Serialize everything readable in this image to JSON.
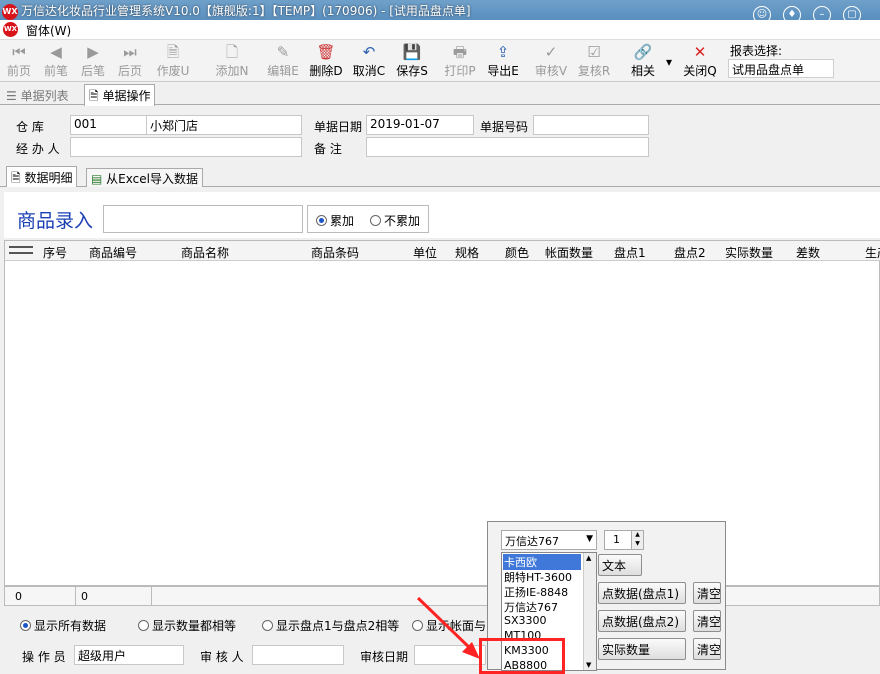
{
  "window": {
    "title": "万信达化妆品行业管理系统V10.0【旗舰版:1】【TEMP】(170906) - [试用品盘点单]",
    "menu": "窗体(W)"
  },
  "toolbar": {
    "buttons": [
      {
        "label": "前页",
        "icon": "⏮",
        "enabled": false
      },
      {
        "label": "前笔",
        "icon": "◀",
        "enabled": false
      },
      {
        "label": "后笔",
        "icon": "▶",
        "enabled": false
      },
      {
        "label": "后页",
        "icon": "⏭",
        "enabled": false
      },
      {
        "label": "作废U",
        "icon": "🗎",
        "enabled": false
      },
      {
        "label": "添加N",
        "icon": "🗋",
        "enabled": false
      },
      {
        "label": "编辑E",
        "icon": "✎",
        "enabled": false
      },
      {
        "label": "删除D",
        "icon": "🗑",
        "enabled": true
      },
      {
        "label": "取消C",
        "icon": "↶",
        "enabled": true
      },
      {
        "label": "保存S",
        "icon": "💾",
        "enabled": true
      },
      {
        "label": "打印P",
        "icon": "🖶",
        "enabled": false
      },
      {
        "label": "导出E",
        "icon": "⇪",
        "enabled": true
      },
      {
        "label": "审核V",
        "icon": "✓",
        "enabled": false
      },
      {
        "label": "复核R",
        "icon": "☑",
        "enabled": false
      },
      {
        "label": "相关",
        "icon": "🔗",
        "enabled": true
      },
      {
        "label": "关闭Q",
        "icon": "✕",
        "enabled": true
      }
    ],
    "report_label": "报表选择:",
    "report_value": "试用品盘点单"
  },
  "tabs": {
    "list": "单据列表",
    "edit": "单据操作"
  },
  "form": {
    "warehouse_label": "仓    库",
    "warehouse_code": "001",
    "warehouse_name": "小郑门店",
    "date_label": "单据日期",
    "date_value": "2019-01-07",
    "docno_label": "单据号码",
    "docno_value": "",
    "handler_label": "经 办 人",
    "handler_value": "",
    "remark_label": "备    注",
    "remark_value": ""
  },
  "subtabs": {
    "detail": "数据明细",
    "excel": "从Excel导入数据"
  },
  "entry": {
    "label": "商品录入",
    "value": "",
    "options": [
      "累加",
      "不累加"
    ],
    "selected": "累加"
  },
  "grid": {
    "columns": [
      "序号",
      "商品编号",
      "商品名称",
      "商品条码",
      "单位",
      "规格",
      "颜色",
      "帐面数量",
      "盘点1",
      "盘点2",
      "实际数量",
      "差数",
      "生产"
    ]
  },
  "footer": {
    "count": "0",
    "sum": "0"
  },
  "filters": {
    "options": [
      "显示所有数据",
      "显示数量都相等",
      "显示盘点1与盘点2相等",
      "显示帐面与"
    ],
    "selected": "显示所有数据"
  },
  "bottom": {
    "operator_label": "操 作 员",
    "operator_value": "超级用户",
    "reviewer_label": "审 核 人",
    "reviewer_value": "",
    "review_date_label": "审核日期",
    "review_date_value": ""
  },
  "popup": {
    "device_selected": "万信达767",
    "spin_value": "1",
    "devices": [
      "卡西欧",
      "朗特HT-3600",
      "正扬IE-8848",
      "万信达767",
      "SX3300",
      "MT100",
      "",
      "KM3300",
      "AB8800"
    ],
    "highlighted": "卡西欧",
    "buttons": {
      "text": "文本",
      "load1": "点数据(盘点1)",
      "clear1": "清空",
      "load2": "点数据(盘点2)",
      "clear2": "清空",
      "actual": "实际数量",
      "clear3": "清空"
    }
  }
}
